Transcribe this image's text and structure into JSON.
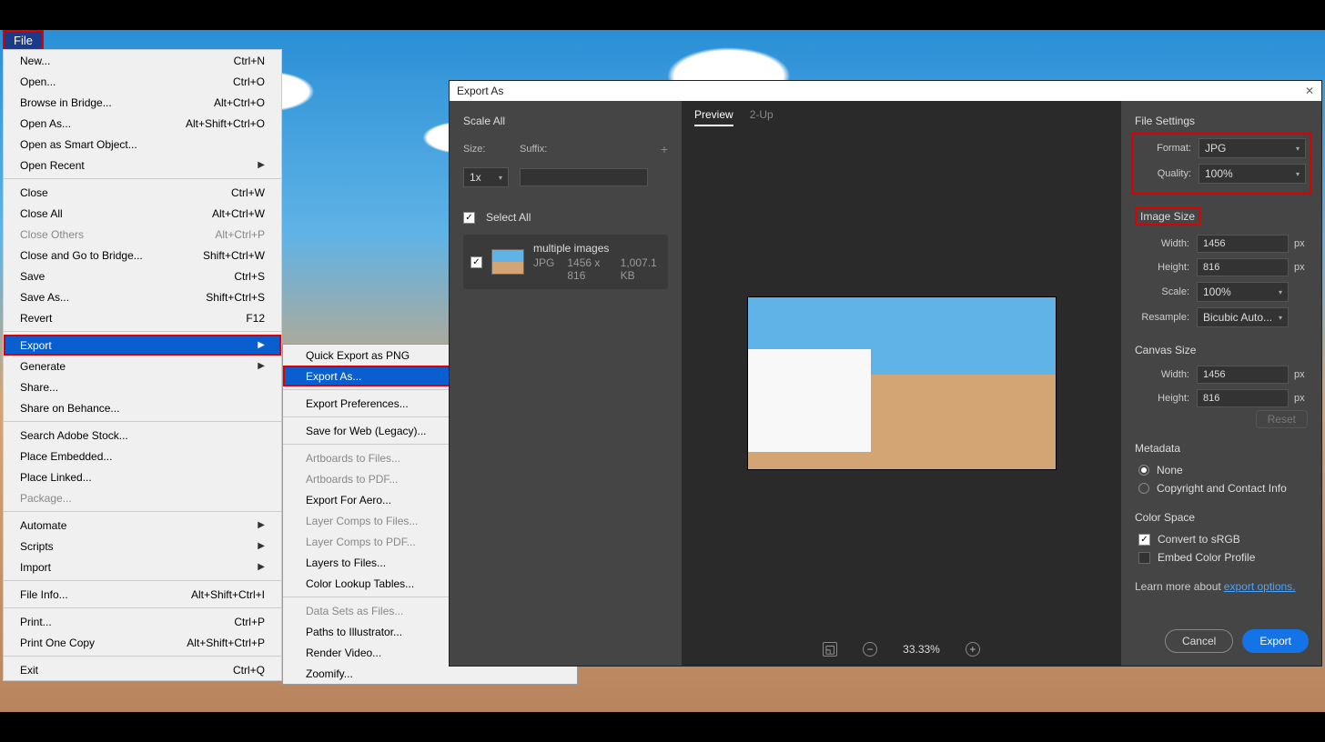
{
  "menubar": {
    "file": "File"
  },
  "menu": {
    "items": [
      {
        "label": "New...",
        "shortcut": "Ctrl+N"
      },
      {
        "label": "Open...",
        "shortcut": "Ctrl+O"
      },
      {
        "label": "Browse in Bridge...",
        "shortcut": "Alt+Ctrl+O"
      },
      {
        "label": "Open As...",
        "shortcut": "Alt+Shift+Ctrl+O"
      },
      {
        "label": "Open as Smart Object...",
        "shortcut": ""
      },
      {
        "label": "Open Recent",
        "shortcut": "",
        "submenu": true
      },
      {
        "sep": true
      },
      {
        "label": "Close",
        "shortcut": "Ctrl+W"
      },
      {
        "label": "Close All",
        "shortcut": "Alt+Ctrl+W"
      },
      {
        "label": "Close Others",
        "shortcut": "Alt+Ctrl+P",
        "disabled": true
      },
      {
        "label": "Close and Go to Bridge...",
        "shortcut": "Shift+Ctrl+W"
      },
      {
        "label": "Save",
        "shortcut": "Ctrl+S"
      },
      {
        "label": "Save As...",
        "shortcut": "Shift+Ctrl+S"
      },
      {
        "label": "Revert",
        "shortcut": "F12"
      },
      {
        "sep": true
      },
      {
        "label": "Export",
        "shortcut": "",
        "submenu": true,
        "highlighted": true
      },
      {
        "label": "Generate",
        "shortcut": "",
        "submenu": true
      },
      {
        "label": "Share...",
        "shortcut": ""
      },
      {
        "label": "Share on Behance...",
        "shortcut": ""
      },
      {
        "sep": true
      },
      {
        "label": "Search Adobe Stock...",
        "shortcut": ""
      },
      {
        "label": "Place Embedded...",
        "shortcut": ""
      },
      {
        "label": "Place Linked...",
        "shortcut": ""
      },
      {
        "label": "Package...",
        "shortcut": "",
        "disabled": true
      },
      {
        "sep": true
      },
      {
        "label": "Automate",
        "shortcut": "",
        "submenu": true
      },
      {
        "label": "Scripts",
        "shortcut": "",
        "submenu": true
      },
      {
        "label": "Import",
        "shortcut": "",
        "submenu": true
      },
      {
        "sep": true
      },
      {
        "label": "File Info...",
        "shortcut": "Alt+Shift+Ctrl+I"
      },
      {
        "sep": true
      },
      {
        "label": "Print...",
        "shortcut": "Ctrl+P"
      },
      {
        "label": "Print One Copy",
        "shortcut": "Alt+Shift+Ctrl+P"
      },
      {
        "sep": true
      },
      {
        "label": "Exit",
        "shortcut": "Ctrl+Q"
      }
    ]
  },
  "submenu": {
    "items": [
      {
        "label": "Quick Export as PNG"
      },
      {
        "label": "Export As...",
        "highlighted": true
      },
      {
        "sep": true
      },
      {
        "label": "Export Preferences..."
      },
      {
        "sep": true
      },
      {
        "label": "Save for Web (Legacy)..."
      },
      {
        "sep": true
      },
      {
        "label": "Artboards to Files...",
        "disabled": true
      },
      {
        "label": "Artboards to PDF...",
        "disabled": true
      },
      {
        "label": "Export For Aero..."
      },
      {
        "label": "Layer Comps to Files...",
        "disabled": true
      },
      {
        "label": "Layer Comps to PDF...",
        "disabled": true
      },
      {
        "label": "Layers to Files..."
      },
      {
        "label": "Color Lookup Tables..."
      },
      {
        "sep": true
      },
      {
        "label": "Data Sets as Files...",
        "disabled": true
      },
      {
        "label": "Paths to Illustrator..."
      },
      {
        "label": "Render Video..."
      },
      {
        "label": "Zoomify..."
      }
    ]
  },
  "dialog": {
    "title": "Export As",
    "close": "✕",
    "scale_all": "Scale All",
    "size_label": "Size:",
    "suffix_label": "Suffix:",
    "size_value": "1x",
    "select_all": "Select All",
    "item": {
      "name": "multiple images",
      "format": "JPG",
      "dims": "1456 x 816",
      "filesize": "1,007.1 KB"
    },
    "tabs": {
      "preview": "Preview",
      "two_up": "2-Up"
    },
    "zoom": "33.33%",
    "file_settings": {
      "heading": "File Settings",
      "format_label": "Format:",
      "format_value": "JPG",
      "quality_label": "Quality:",
      "quality_value": "100%"
    },
    "image_size": {
      "heading": "Image Size",
      "width_label": "Width:",
      "width_value": "1456",
      "height_label": "Height:",
      "height_value": "816",
      "scale_label": "Scale:",
      "scale_value": "100%",
      "resample_label": "Resample:",
      "resample_value": "Bicubic Auto...",
      "px": "px"
    },
    "canvas_size": {
      "heading": "Canvas Size",
      "width_label": "Width:",
      "width_value": "1456",
      "height_label": "Height:",
      "height_value": "816",
      "px": "px",
      "reset": "Reset"
    },
    "metadata": {
      "heading": "Metadata",
      "none": "None",
      "copyright": "Copyright and Contact Info"
    },
    "color_space": {
      "heading": "Color Space",
      "convert": "Convert to sRGB",
      "embed": "Embed Color Profile"
    },
    "learn_more": "Learn more about",
    "learn_link": "export options.",
    "cancel": "Cancel",
    "export": "Export"
  }
}
